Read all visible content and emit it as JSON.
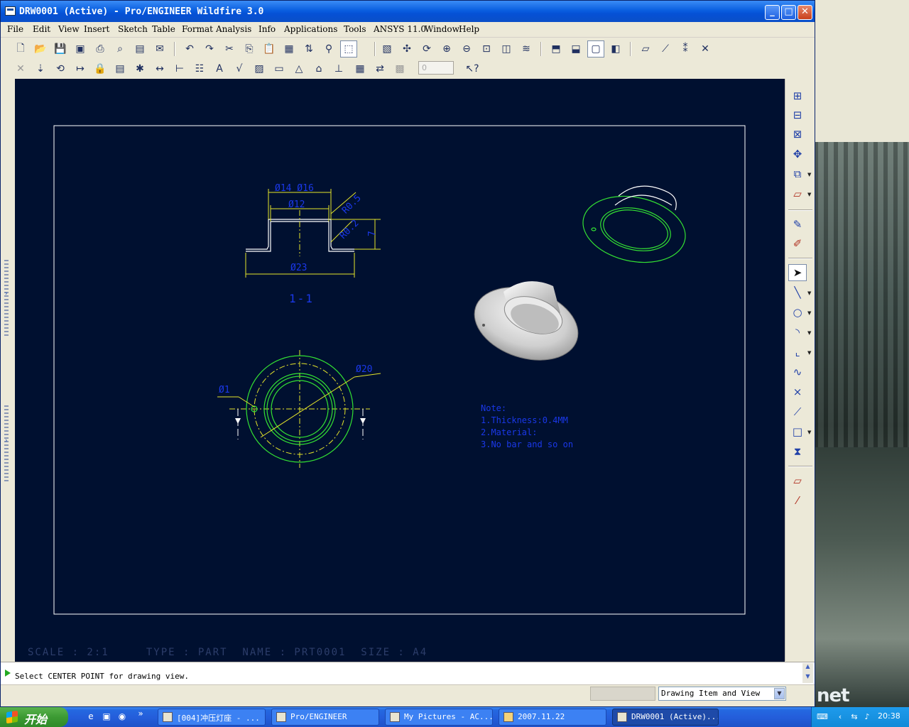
{
  "window": {
    "title": "DRW0001 (Active) - Pro/ENGINEER Wildfire 3.0",
    "controls": {
      "minimize": "_",
      "maximize": "□",
      "close": "✕"
    }
  },
  "menubar": {
    "items": [
      "File",
      "Edit",
      "View",
      "Insert",
      "Sketch",
      "Table",
      "Format",
      "Analysis",
      "Info",
      "Applications",
      "Tools",
      "ANSYS 11.0",
      "Window",
      "Help"
    ]
  },
  "toolbar": {
    "spin_value": "0",
    "row1_icons": [
      "new-icon",
      "open-icon",
      "save-icon",
      "save-copy-icon",
      "print-icon",
      "preview-icon",
      "pdf-icon",
      "send-icon",
      "undo-icon",
      "redo-icon",
      "cut-icon",
      "copy-icon",
      "paste-icon",
      "paste-special-icon",
      "regenerate-icon",
      "find-icon",
      "select-box-icon",
      "repaint-icon",
      "spin-center-icon",
      "orient-icon",
      "zoom-in-icon",
      "zoom-out-icon",
      "refit-icon",
      "saved-views-icon",
      "layers-icon",
      "wireframe-icon",
      "hidden-line-icon",
      "no-hidden-icon",
      "shading-icon",
      "datum-planes-icon",
      "datum-axes-icon",
      "datum-points-icon",
      "coordinate-systems-icon"
    ],
    "row2_icons": [
      "delete-icon",
      "select-icon",
      "regen-view-icon",
      "move-view-icon",
      "lock-icon",
      "table-icon",
      "show-annotations-icon",
      "dimension-icon",
      "ordinate-icon",
      "baseline-icon",
      "note-icon",
      "surface-finish-icon",
      "hatch-icon",
      "scale-note-icon",
      "balloon-icon",
      "symbol-icon",
      "gtol-icon",
      "repeat-region-icon",
      "switch-view-icon",
      "layer-display-icon",
      "context-help-icon"
    ]
  },
  "drawing": {
    "section_label": "1-1",
    "dimensions": {
      "outer_top": "Ø14 Ø16",
      "inner_top": "Ø12",
      "radius_top": "R0.5",
      "radius_side": "R0.2",
      "height": "7",
      "flange": "Ø23",
      "hole": "Ø1",
      "pcd": "Ø20"
    },
    "note_title": "Note:",
    "notes": [
      "1.Thickness:0.4MM",
      "2.Material:",
      "3.No bar and so on"
    ],
    "scale_line": "SCALE : 2:1     TYPE : PART  NAME : PRT0001  SIZE : A4"
  },
  "right_toolbar": {
    "icons": [
      "create-view-icon",
      "projection-view-icon",
      "detailed-view-icon",
      "move-item-icon",
      "sheet-icon",
      "plane-icon",
      "annotations-icon",
      "snapshot-icon",
      "select-arrow-icon",
      "line-icon",
      "circle-icon",
      "arc-icon",
      "fillet-icon",
      "spline-icon",
      "point-icon",
      "chamfer-icon",
      "rectangle-icon",
      "mirror-icon",
      "datum-plane-icon",
      "datum-axis-icon"
    ]
  },
  "message": {
    "text": "Select CENTER POINT for drawing view."
  },
  "statusbar": {
    "filter_value": "Drawing Item and View"
  },
  "taskbar": {
    "start_label": "开始",
    "tasks": [
      {
        "label": "[004]冲压灯座 - ...",
        "active": false
      },
      {
        "label": "Pro/ENGINEER",
        "active": false
      },
      {
        "label": "My Pictures - AC...",
        "active": false
      },
      {
        "label": "2007.11.22",
        "active": false
      },
      {
        "label": "DRW0001 (Active)...",
        "active": true
      }
    ],
    "clock": "20:38"
  },
  "desktop": {
    "watermark": "net"
  },
  "colors": {
    "canvas": "#001030",
    "dimension": "#e6e62a",
    "text_blue": "#1a38e8",
    "edge_green": "#33e033",
    "titlebar": "#0a5fe0"
  }
}
